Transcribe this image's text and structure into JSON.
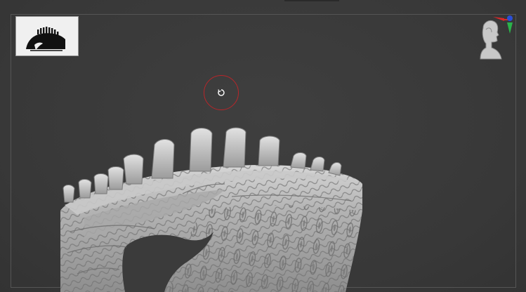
{
  "viewport": {
    "canvas_label": "",
    "background_color": "#3a3a3a",
    "model_color": "#bdbdbd",
    "brush_ring_color": "#b8262a"
  },
  "navigator": {
    "icon": "model-silhouette-icon"
  },
  "gizmo": {
    "icon": "head-orientation-icon",
    "axis_colors": {
      "x": "#d8282a",
      "y": "#2bb34a",
      "z": "#2b4fd6"
    }
  },
  "brush": {
    "icon": "brush-cursor-icon"
  }
}
